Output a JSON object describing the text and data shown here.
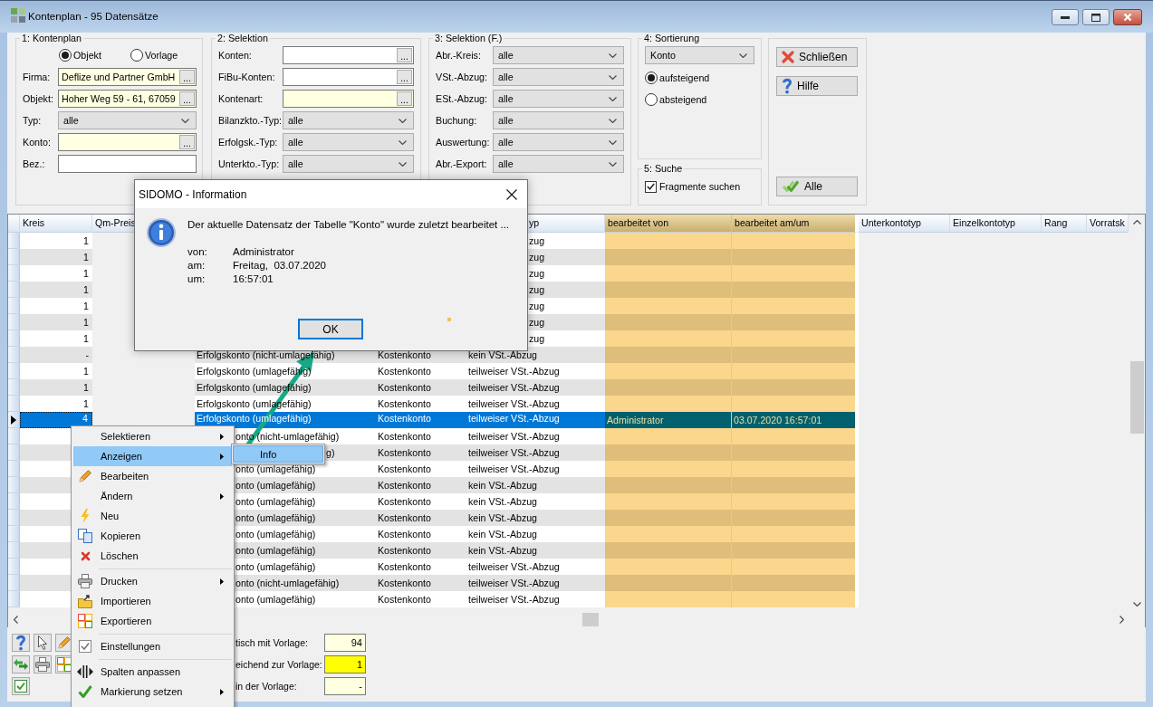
{
  "window": {
    "title": "Kontenplan - 95 Datensätze"
  },
  "kontenplan": {
    "title": "1: Kontenplan",
    "source": [
      {
        "label": "Objekt",
        "selected": true
      },
      {
        "label": "Vorlage",
        "selected": false
      }
    ],
    "fields": [
      {
        "kind": "lookup",
        "label": "Firma:",
        "value": "Deflize und Partner GmbH",
        "button": "...",
        "highlighted": true
      },
      {
        "kind": "lookup",
        "label": "Objekt:",
        "value": "Hoher Weg 59 - 61, 67059",
        "button": "...",
        "highlighted": true
      },
      {
        "kind": "select",
        "label": "Typ:",
        "value": "alle",
        "highlighted": false
      },
      {
        "kind": "lookup",
        "label": "Konto:",
        "button": "...",
        "highlighted": true
      },
      {
        "kind": "text",
        "label": "Bez.:",
        "highlighted": false
      }
    ]
  },
  "selektion": {
    "title": "2: Selektion",
    "fields": [
      {
        "kind": "lookup",
        "label": "Konten:",
        "button": "...",
        "highlighted": false
      },
      {
        "kind": "lookup",
        "label": "FiBu-Konten:",
        "button": "...",
        "highlighted": false
      },
      {
        "kind": "lookup",
        "label": "Kontenart:",
        "button": "...",
        "highlighted": true
      },
      {
        "kind": "select",
        "label": "Bilanzkto.-Typ:",
        "value": "alle",
        "highlighted": false
      },
      {
        "kind": "select",
        "label": "Erfolgsk.-Typ:",
        "value": "alle",
        "highlighted": false
      },
      {
        "kind": "select",
        "label": "Unterkto.-Typ:",
        "value": "alle",
        "highlighted": false
      }
    ]
  },
  "selektion_f": {
    "title": "3: Selektion (F.)",
    "fields": [
      {
        "kind": "select",
        "label": "Abr.-Kreis:",
        "value": "alle",
        "highlighted": false
      },
      {
        "kind": "select",
        "label": "VSt.-Abzug:",
        "value": "alle",
        "highlighted": false
      },
      {
        "kind": "select",
        "label": "ESt.-Abzug:",
        "value": "alle",
        "highlighted": false
      },
      {
        "kind": "select",
        "label": "Buchung:",
        "value": "alle",
        "highlighted": false
      },
      {
        "kind": "select",
        "label": "Auswertung:",
        "value": "alle",
        "highlighted": false
      },
      {
        "kind": "select",
        "label": "Abr.-Export:",
        "value": "alle",
        "highlighted": false
      }
    ]
  },
  "sortierung": {
    "title": "4: Sortierung",
    "field": {
      "kind": "select",
      "value": "Konto",
      "highlighted": false
    },
    "order": [
      {
        "label": "aufsteigend",
        "selected": true
      },
      {
        "label": "absteigend",
        "selected": false
      }
    ]
  },
  "suche": {
    "title": "5: Suche",
    "options": [
      {
        "label": "Fragmente suchen",
        "checked": true
      }
    ]
  },
  "buttons": [
    {
      "label": "Schließen"
    },
    {
      "label": "Hilfe"
    },
    {
      "label": "Alle"
    }
  ],
  "table": {
    "columns": [
      {
        "label": "Kreis",
        "highlighted": false,
        "disabled": false
      },
      {
        "label": "Qm-Preis",
        "highlighted": false,
        "disabled": true
      },
      {
        "highlighted": false,
        "disabled": false
      },
      {
        "highlighted": false,
        "disabled": false
      },
      {
        "label": "yp",
        "highlighted": false,
        "disabled": false
      },
      {
        "label": "bearbeitet von",
        "highlighted": true,
        "disabled": false
      },
      {
        "label": "bearbeitet am/um",
        "highlighted": true,
        "disabled": false
      },
      {
        "label": "Unterkontotyp",
        "highlighted": false
      },
      {
        "label": "Einzelkontotyp",
        "highlighted": false
      },
      {
        "label": "Rang",
        "highlighted": false
      },
      {
        "label": "Vorratsk",
        "highlighted": false
      }
    ],
    "rows": [
      {
        "selected": false,
        "kreis": "1",
        "column_5": "zug"
      },
      {
        "selected": false,
        "kreis": "1",
        "column_5": "zug"
      },
      {
        "selected": false,
        "kreis": "1",
        "column_5": "zug"
      },
      {
        "selected": false,
        "kreis": "1",
        "column_5": "zug"
      },
      {
        "selected": false,
        "kreis": "1",
        "column_5": "zug"
      },
      {
        "selected": false,
        "kreis": "1",
        "column_5": "zug"
      },
      {
        "selected": false,
        "kreis": "1",
        "column_5": "zug"
      },
      {
        "selected": false,
        "kreis": "-",
        "column_3": "Erfolgskonto (nicht-umlagefähig)",
        "column_4": "Kostenkonto",
        "column_5": "kein VSt.-Abzug"
      },
      {
        "selected": false,
        "kreis": "1",
        "column_3": "Erfolgskonto (umlagefähig)",
        "column_4": "Kostenkonto",
        "column_5": "teilweiser VSt.-Abzug"
      },
      {
        "selected": false,
        "kreis": "1",
        "column_3": "Erfolgskonto (umlagefähig)",
        "column_4": "Kostenkonto",
        "column_5": "teilweiser VSt.-Abzug"
      },
      {
        "selected": false,
        "kreis": "1",
        "column_3": "Erfolgskonto (umlagefähig)",
        "column_4": "Kostenkonto",
        "column_5": "teilweiser VSt.-Abzug"
      },
      {
        "selected": true,
        "kreis": "4",
        "column_3": "Erfolgskonto (umlagefähig)",
        "column_4": "Kostenkonto",
        "column_5": "teilweiser VSt.-Abzug",
        "bearbeitet_von": "Administrator",
        "bearbeitet_am_um": "03.07.2020 16:57:01"
      },
      {
        "selected": false,
        "column_3": "onto (nicht-umlagefähig)",
        "column_4": "Kostenkonto",
        "column_5": "teilweiser VSt.-Abzug"
      },
      {
        "selected": false,
        "column_3": "g)",
        "column_4": "Kostenkonto",
        "column_5": "teilweiser VSt.-Abzug"
      },
      {
        "selected": false,
        "column_3": "onto (umlagefähig)",
        "column_4": "Kostenkonto",
        "column_5": "teilweiser VSt.-Abzug"
      },
      {
        "selected": false,
        "column_3": "onto (umlagefähig)",
        "column_4": "Kostenkonto",
        "column_5": "kein VSt.-Abzug"
      },
      {
        "selected": false,
        "column_3": "onto (umlagefähig)",
        "column_4": "Kostenkonto",
        "column_5": "kein VSt.-Abzug"
      },
      {
        "selected": false,
        "column_3": "onto (umlagefähig)",
        "column_4": "Kostenkonto",
        "column_5": "kein VSt.-Abzug"
      },
      {
        "selected": false,
        "column_3": "onto (umlagefähig)",
        "column_4": "Kostenkonto",
        "column_5": "kein VSt.-Abzug"
      },
      {
        "selected": false,
        "column_3": "onto (umlagefähig)",
        "column_4": "Kostenkonto",
        "column_5": "kein VSt.-Abzug"
      },
      {
        "selected": false,
        "column_3": "onto (umlagefähig)",
        "column_4": "Kostenkonto",
        "column_5": "teilweiser VSt.-Abzug"
      },
      {
        "selected": false,
        "column_3": "onto (nicht-umlagefähig)",
        "column_4": "Kostenkonto",
        "column_5": "teilweiser VSt.-Abzug"
      },
      {
        "selected": false,
        "column_3": "onto (umlagefähig)",
        "column_4": "Kostenkonto",
        "column_5": "teilweiser VSt.-Abzug"
      }
    ]
  },
  "summary": [
    {
      "label": "tisch mit Vorlage:",
      "value": "94",
      "highlighted": false
    },
    {
      "label": "eichend zur Vorlage:",
      "value": "1",
      "highlighted": true
    },
    {
      "label": "in der Vorlage:",
      "value": "-",
      "highlighted": false
    }
  ],
  "context_menu": {
    "items": [
      {
        "kind": "item",
        "label": "Selektieren",
        "submenu": true,
        "selected": false
      },
      {
        "kind": "item",
        "label": "Anzeigen",
        "submenu": true,
        "selected": true
      },
      {
        "kind": "item",
        "label": "Bearbeiten",
        "submenu": false,
        "selected": false
      },
      {
        "kind": "item",
        "label": "Ändern",
        "submenu": true,
        "selected": false
      },
      {
        "kind": "item",
        "label": "Neu",
        "submenu": false,
        "selected": false
      },
      {
        "kind": "item",
        "label": "Kopieren",
        "submenu": false,
        "selected": false
      },
      {
        "kind": "item",
        "label": "Löschen",
        "submenu": false,
        "selected": false
      },
      {
        "kind": "separator"
      },
      {
        "kind": "item",
        "label": "Drucken",
        "submenu": true,
        "selected": false
      },
      {
        "kind": "item",
        "label": "Importieren",
        "submenu": false,
        "selected": false
      },
      {
        "kind": "item",
        "label": "Exportieren",
        "submenu": false,
        "selected": false
      },
      {
        "kind": "separator"
      },
      {
        "kind": "item",
        "label": "Einstellungen",
        "submenu": false,
        "selected": false
      },
      {
        "kind": "separator"
      },
      {
        "kind": "item",
        "label": "Spalten anpassen",
        "submenu": false,
        "selected": false
      },
      {
        "kind": "item",
        "label": "Markierung setzen",
        "submenu": true,
        "selected": false
      }
    ]
  },
  "submenu": {
    "items": [
      {
        "label": "Info",
        "selected": true
      }
    ]
  },
  "dialog": {
    "title": "SIDOMO - Information",
    "message": "Der aktuelle Datensatz der Tabelle \"Konto\" wurde zuletzt bearbeitet ...",
    "details": [
      {
        "label": "von:",
        "value": "Administrator"
      },
      {
        "label": "am:",
        "value": "Freitag,  03.07.2020"
      },
      {
        "label": "um:",
        "value": "16:57:01"
      }
    ],
    "button": "OK"
  }
}
